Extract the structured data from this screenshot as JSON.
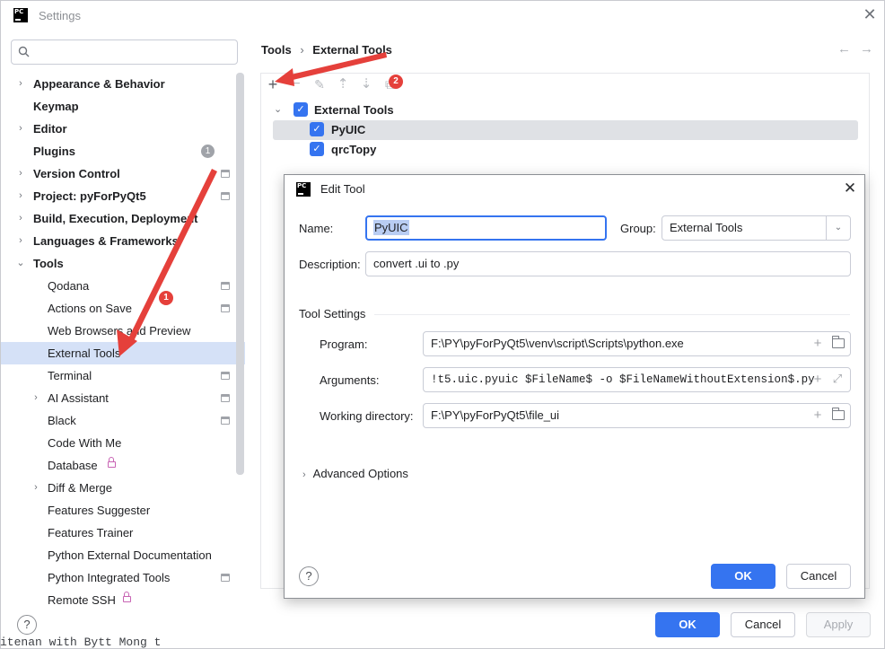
{
  "window": {
    "title": "Settings",
    "close_glyph": "✕",
    "app_icon": "pycharm-logo"
  },
  "sidebar": {
    "search_placeholder": "",
    "items": [
      {
        "label": "Appearance & Behavior",
        "expandable": true
      },
      {
        "label": "Keymap"
      },
      {
        "label": "Editor",
        "expandable": true
      },
      {
        "label": "Plugins",
        "badge": "1"
      },
      {
        "label": "Version Control",
        "expandable": true
      },
      {
        "label": "Project: pyForPyQt5",
        "expandable": true
      },
      {
        "label": "Build, Execution, Deployment",
        "expandable": true
      },
      {
        "label": "Languages & Frameworks",
        "expandable": true
      },
      {
        "label": "Tools",
        "expanded": true
      },
      {
        "label": "Qodana"
      },
      {
        "label": "Actions on Save"
      },
      {
        "label": "Web Browsers and Preview"
      },
      {
        "label": "External Tools",
        "selected": true
      },
      {
        "label": "Terminal"
      },
      {
        "label": "AI Assistant",
        "expandable": true
      },
      {
        "label": "Black"
      },
      {
        "label": "Code With Me"
      },
      {
        "label": "Database"
      },
      {
        "label": "Diff & Merge",
        "expandable": true
      },
      {
        "label": "Features Suggester"
      },
      {
        "label": "Features Trainer"
      },
      {
        "label": "Python External Documentation"
      },
      {
        "label": "Python Integrated Tools"
      },
      {
        "label": "Remote SSH"
      }
    ],
    "behind_text": "itenan with Bytt Mong t"
  },
  "breadcrumb": {
    "parent": "Tools",
    "separator": "›",
    "current": "External Tools"
  },
  "nav": {
    "back_glyph": "←",
    "forward_glyph": "→"
  },
  "toolbar": {
    "add": "+",
    "remove": "−",
    "edit": "✎",
    "up": "⇡",
    "down": "⇣",
    "copy": "⧉",
    "badge": "2"
  },
  "tool_tree": {
    "group": "External Tools",
    "tools": [
      "PyUIC",
      "qrcTopy"
    ]
  },
  "annotations": {
    "marker_1": "1",
    "marker_2": "2"
  },
  "dialog": {
    "title": "Edit Tool",
    "name_label": "Name:",
    "name_value": "PyUIC",
    "group_label": "Group:",
    "group_value": "External Tools",
    "description_label": "Description:",
    "description_value": "convert .ui to .py",
    "section_title": "Tool Settings",
    "program_label": "Program:",
    "program_value": "F:\\PY\\pyForPyQt5\\venv\\script\\Scripts\\python.exe",
    "arguments_label": "Arguments:",
    "arguments_value": "!t5.uic.pyuic $FileName$ -o $FileNameWithoutExtension$.py",
    "workdir_label": "Working directory:",
    "workdir_value": "F:\\PY\\pyForPyQt5\\file_ui",
    "advanced_label": "Advanced Options",
    "ok_label": "OK",
    "cancel_label": "Cancel",
    "help_glyph": "?"
  },
  "footer": {
    "ok_label": "OK",
    "cancel_label": "Cancel",
    "apply_label": "Apply",
    "help_glyph": "?"
  },
  "colors": {
    "accent": "#3574f0",
    "selection": "#d5e1f7",
    "annotation": "#e5403b"
  }
}
